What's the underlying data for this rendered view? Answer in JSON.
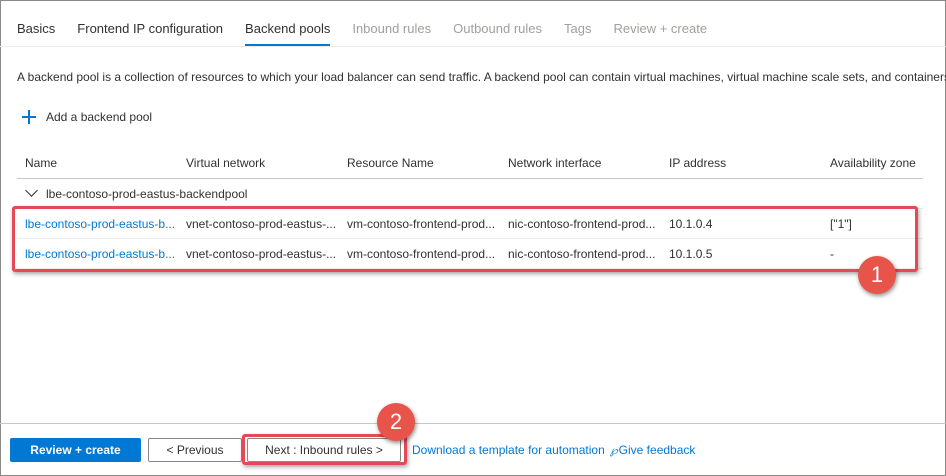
{
  "tabs": [
    {
      "label": "Basics",
      "state": "normal"
    },
    {
      "label": "Frontend IP configuration",
      "state": "normal"
    },
    {
      "label": "Backend pools",
      "state": "active"
    },
    {
      "label": "Inbound rules",
      "state": "disabled"
    },
    {
      "label": "Outbound rules",
      "state": "disabled"
    },
    {
      "label": "Tags",
      "state": "disabled"
    },
    {
      "label": "Review + create",
      "state": "disabled"
    }
  ],
  "description": "A backend pool is a collection of resources to which your load balancer can send traffic. A backend pool can contain virtual machines, virtual machine scale sets, and containers.",
  "add_button": {
    "label": "Add a backend pool",
    "icon": "plus-icon"
  },
  "table": {
    "columns": [
      "Name",
      "Virtual network",
      "Resource Name",
      "Network interface",
      "IP address",
      "Availability zone"
    ],
    "group": {
      "label": "lbe-contoso-prod-eastus-backendpool",
      "icon": "chevron-down-icon"
    },
    "rows": [
      {
        "name": "lbe-contoso-prod-eastus-b...",
        "vnet": "vnet-contoso-prod-eastus-...",
        "resource": "vm-contoso-frontend-prod...",
        "nic": "nic-contoso-frontend-prod...",
        "ip": "10.1.0.4",
        "zone": "[\"1\"]"
      },
      {
        "name": "lbe-contoso-prod-eastus-b...",
        "vnet": "vnet-contoso-prod-eastus-...",
        "resource": "vm-contoso-frontend-prod...",
        "nic": "nic-contoso-frontend-prod...",
        "ip": "10.1.0.5",
        "zone": "-"
      }
    ]
  },
  "callouts": {
    "badge1": "1",
    "badge2": "2",
    "color": "#e74856"
  },
  "footer": {
    "review_create": "Review + create",
    "previous": "< Previous",
    "next": "Next : Inbound rules >",
    "download_template": "Download a template for automation",
    "feedback": "Give feedback",
    "feedback_icon": "feedback-icon"
  },
  "colors": {
    "accent": "#0078d4",
    "highlight": "#e74856"
  }
}
